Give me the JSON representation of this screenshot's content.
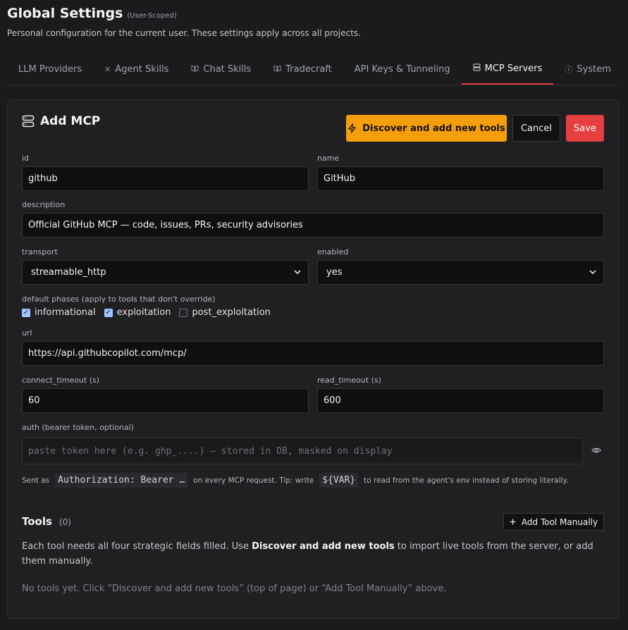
{
  "header": {
    "title": "Global Settings",
    "scope": "(User-Scoped)",
    "subtitle": "Personal configuration for the current user. These settings apply across all projects."
  },
  "tabs": [
    {
      "label": "LLM Providers",
      "icon": "",
      "active": false
    },
    {
      "label": "Agent Skills",
      "icon": "tools-icon",
      "active": false
    },
    {
      "label": "Chat Skills",
      "icon": "book-icon",
      "active": false
    },
    {
      "label": "Tradecraft",
      "icon": "book-icon",
      "active": false
    },
    {
      "label": "API Keys & Tunneling",
      "icon": "",
      "active": false
    },
    {
      "label": "MCP Servers",
      "icon": "server-icon",
      "active": true
    },
    {
      "label": "System",
      "icon": "info-icon",
      "active": false
    }
  ],
  "card": {
    "title": "Add MCP",
    "discover_label": "Discover and add new tools",
    "cancel_label": "Cancel",
    "save_label": "Save"
  },
  "form": {
    "id": {
      "label": "id",
      "value": "github"
    },
    "name": {
      "label": "name",
      "value": "GitHub"
    },
    "description": {
      "label": "description",
      "value": "Official GitHub MCP — code, issues, PRs, security advisories"
    },
    "transport": {
      "label": "transport",
      "value": "streamable_http"
    },
    "enabled": {
      "label": "enabled",
      "value": "yes"
    },
    "phases": {
      "label": "default phases (apply to tools that don't override)",
      "options": [
        {
          "label": "informational",
          "checked": true
        },
        {
          "label": "exploitation",
          "checked": true
        },
        {
          "label": "post_exploitation",
          "checked": false
        }
      ]
    },
    "url": {
      "label": "url",
      "value": "https://api.githubcopilot.com/mcp/"
    },
    "connect_timeout": {
      "label": "connect_timeout (s)",
      "value": "60"
    },
    "read_timeout": {
      "label": "read_timeout (s)",
      "value": "600"
    },
    "auth": {
      "label": "auth (bearer token, optional)",
      "placeholder": "paste token here (e.g. ghp_....) — stored in DB, masked on display"
    },
    "hint": {
      "prefix": "Sent as",
      "code1": "Authorization: Bearer …",
      "middle": "on every MCP request. Tip: write",
      "code2": "${VAR}",
      "suffix": "to read from the agent's env instead of storing literally."
    }
  },
  "tools": {
    "title": "Tools",
    "count": "(0)",
    "add_label": "Add Tool Manually",
    "desc_prefix": "Each tool needs all four strategic fields filled. Use ",
    "desc_bold": "Discover and add new tools",
    "desc_suffix": " to import live tools from the server, or add them manually.",
    "empty": "No tools yet. Click “Discover and add new tools” (top of page) or “Add Tool Manually” above."
  }
}
